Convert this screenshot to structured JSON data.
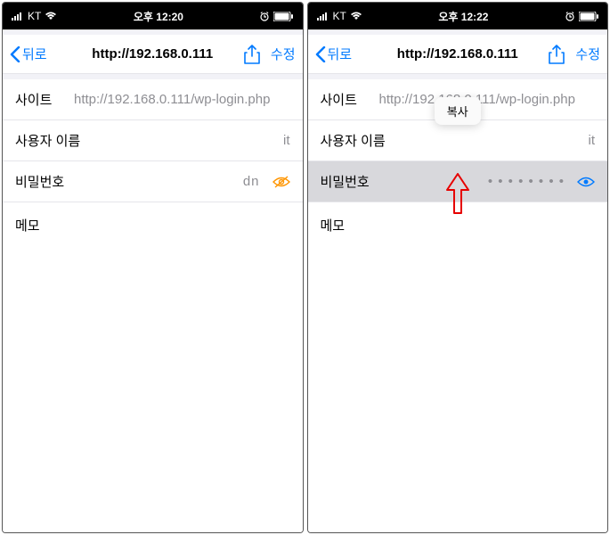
{
  "screens": [
    {
      "status": {
        "carrier": "KT",
        "time": "오후 12:20"
      },
      "nav": {
        "back": "뒤로",
        "title": "http://192.168.0.111",
        "edit": "수정"
      },
      "rows": {
        "site_label": "사이트",
        "site_value": "http://192.168.0.111/wp-login.php",
        "user_label": "사용자 이름",
        "user_value": "it",
        "pass_label": "비밀번호",
        "pass_value": "dn",
        "memo_label": "메모"
      }
    },
    {
      "status": {
        "carrier": "KT",
        "time": "오후 12:22"
      },
      "nav": {
        "back": "뒤로",
        "title": "http://192.168.0.111",
        "edit": "수정"
      },
      "rows": {
        "site_label": "사이트",
        "site_value": "http://192.168.0.111/wp-login.php",
        "user_label": "사용자 이름",
        "user_value": "it",
        "pass_label": "비밀번호",
        "pass_value": "• • • • • • • •",
        "memo_label": "메모"
      },
      "popover": {
        "copy_label": "복사"
      }
    }
  ]
}
